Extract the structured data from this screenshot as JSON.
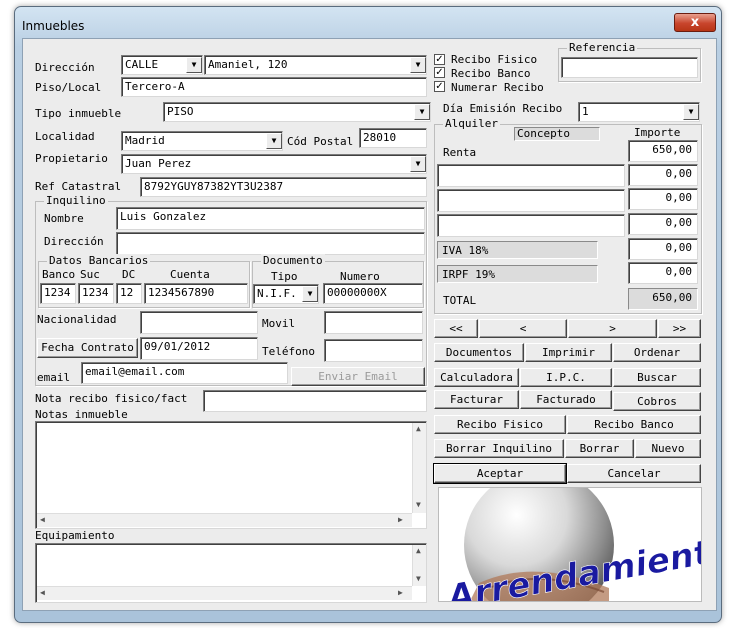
{
  "window": {
    "title": "Inmuebles",
    "close_label": "x"
  },
  "labels": {
    "direccion": "Dirección",
    "piso_local": "Piso/Local",
    "tipo_inmueble": "Tipo inmueble",
    "localidad": "Localidad",
    "cod_postal": "Cód Postal",
    "propietario": "Propietario",
    "ref_catastral": "Ref Catastral",
    "inquilino": "Inquilino",
    "nombre": "Nombre",
    "direccion_inq": "Dirección",
    "datos_bancarios": "Datos Bancarios",
    "banco": "Banco",
    "suc": "Suc",
    "dc": "DC",
    "cuenta": "Cuenta",
    "documento": "Documento",
    "tipo": "Tipo",
    "numero": "Numero",
    "nacionalidad": "Nacionalidad",
    "movil": "Movil",
    "telefono": "Teléfono",
    "email": "email",
    "nota_recibo": "Nota recibo fisico/fact",
    "notas_inmueble": "Notas inmueble",
    "equipamiento": "Equipamiento",
    "referencia": "Referencia",
    "dia_emision": "Día Emisión Recibo",
    "alquiler": "Alquiler",
    "concepto": "Concepto",
    "importe": "Importe",
    "total": "TOTAL"
  },
  "fields": {
    "via_tipo": "CALLE",
    "direccion": "Amaniel, 120",
    "piso_local": "Tercero-A",
    "tipo_inmueble": "PISO",
    "localidad": "Madrid",
    "cod_postal": "28010",
    "propietario": "Juan Perez",
    "ref_catastral": "8792YGUY87382YT3U2387",
    "nombre": "Luis Gonzalez",
    "direccion_inq": "",
    "banco": "1234",
    "suc": "1234",
    "dc": "12",
    "cuenta": "1234567890",
    "doc_tipo": "N.I.F.",
    "doc_numero": "00000000X",
    "nacionalidad": "",
    "movil": "",
    "fecha_contrato": "09/01/2012",
    "telefono": "",
    "email": "email@email.com",
    "nota_recibo": "",
    "referencia": "",
    "dia_emision": "1"
  },
  "checks": [
    {
      "label": "Recibo Fisico",
      "checked": true
    },
    {
      "label": "Recibo Banco",
      "checked": true
    },
    {
      "label": "Numerar Recibo",
      "checked": true
    }
  ],
  "conceptos": [
    {
      "concepto": "Renta",
      "importe": "650,00"
    },
    {
      "concepto": "",
      "importe": "0,00"
    },
    {
      "concepto": "",
      "importe": "0,00"
    },
    {
      "concepto": "",
      "importe": "0,00"
    },
    {
      "concepto": "IVA 18%",
      "importe": "0,00"
    },
    {
      "concepto": "IRPF 19%",
      "importe": "0,00"
    }
  ],
  "total": "650,00",
  "buttons": {
    "fecha_contrato": "Fecha Contrato",
    "enviar_email": "Enviar Email",
    "first": "<<",
    "prev": "<",
    "next": ">",
    "last": ">>",
    "documentos": "Documentos",
    "imprimir": "Imprimir",
    "ordenar": "Ordenar",
    "calculadora": "Calculadora",
    "ipc": "I.P.C.",
    "buscar": "Buscar",
    "facturar": "Facturar",
    "facturado": "Facturado",
    "cobros": "Cobros",
    "recibo_fisico": "Recibo Fisico",
    "recibo_banco": "Recibo Banco",
    "borrar_inquilino": "Borrar Inquilino",
    "borrar": "Borrar",
    "nuevo": "Nuevo",
    "aceptar": "Aceptar",
    "cancelar": "Cancelar"
  },
  "logo": {
    "text": "Arrendamientos.es"
  }
}
